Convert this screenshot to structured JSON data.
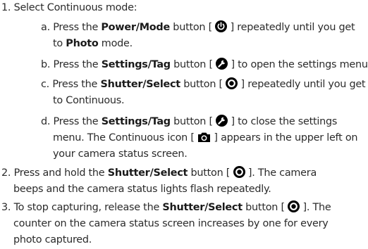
{
  "steps": [
    {
      "num": "1.",
      "text": "Select Continuous mode:"
    },
    {
      "sub": [
        {
          "letter": "a.",
          "l1_pre": "Press the ",
          "l1_bold": "Power/Mode",
          "l1_mid": " button [ ",
          "icon": "power-mode-icon",
          "l1_post": " ] repeatedly until you get",
          "l2_pre": "to ",
          "l2_bold": "Photo",
          "l2_post": " mode."
        },
        {
          "letter": "b.",
          "l1_pre": "Press the ",
          "l1_bold": "Settings/Tag",
          "l1_mid": " button [ ",
          "icon": "wrench-icon",
          "l1_post": " ] to open the settings menu."
        },
        {
          "letter": "c.",
          "l1_pre": "Press the ",
          "l1_bold": "Shutter/Select",
          "l1_mid": " button [ ",
          "icon": "shutter-icon",
          "l1_post": " ] repeatedly until you get",
          "l2": "to Continuous."
        },
        {
          "letter": "d.",
          "l1_pre": "Press the ",
          "l1_bold": "Settings/Tag",
          "l1_mid": " button [ ",
          "icon": "wrench-icon",
          "l1_post": " ] to close the settings",
          "l2_pre": "menu. The Continuous icon [ ",
          "icon2": "camera-icon",
          "l2_post": " ] appears in the upper left on",
          "l3": "your camera status screen."
        }
      ]
    },
    {
      "num": "2.",
      "l1_pre": "Press and hold the ",
      "l1_bold": "Shutter/Select",
      "l1_mid": " button [ ",
      "icon": "shutter-icon",
      "l1_post": " ]. The camera",
      "l2": "beeps and the camera status lights flash repeatedly."
    },
    {
      "num": "3.",
      "l1_pre": "To stop capturing, release the ",
      "l1_bold": "Shutter/Select",
      "l1_mid": " button [ ",
      "icon": "shutter-icon",
      "l1_post": " ]. The",
      "l2": "counter on the camera status screen increases by one for every",
      "l3": "photo captured."
    }
  ]
}
